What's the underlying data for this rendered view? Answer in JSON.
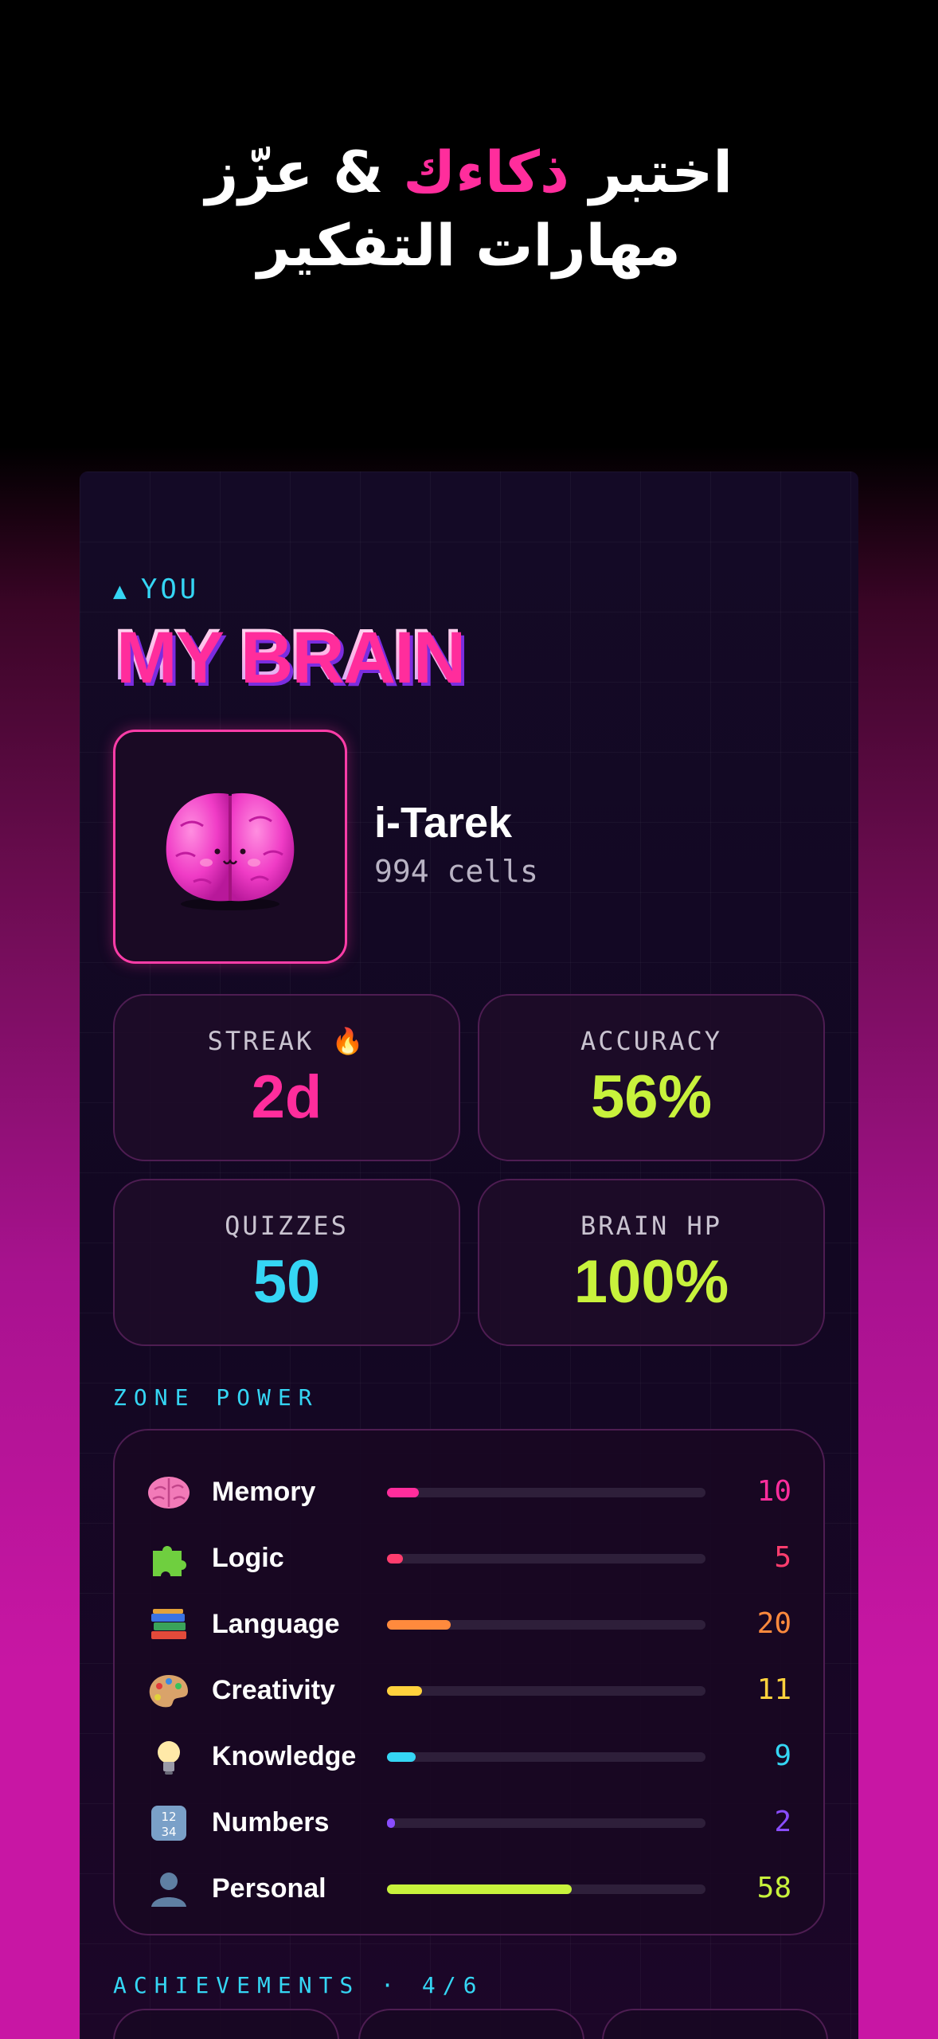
{
  "headline": {
    "line1_a": "اختبر ",
    "line1_accent": "ذكاءك",
    "line1_b": " & عزّز",
    "line2": "مهارات التفكير"
  },
  "profile": {
    "section_label": "YOU",
    "title": "MY BRAIN",
    "username": "i-Tarek",
    "cells": "994 cells"
  },
  "stats": [
    {
      "label": "STREAK 🔥",
      "value": "2d",
      "color": "#ff2d9c"
    },
    {
      "label": "ACCURACY",
      "value": "56%",
      "color": "#c8f23c"
    },
    {
      "label": "QUIZZES",
      "value": "50",
      "color": "#35d6f4"
    },
    {
      "label": "BRAIN HP",
      "value": "100%",
      "color": "#c8f23c"
    }
  ],
  "zone_power": {
    "label": "ZONE POWER",
    "zones": [
      {
        "icon": "brain-icon",
        "name": "Memory",
        "value": "10",
        "fraction": 0.1,
        "color": "#ff2d9c"
      },
      {
        "icon": "puzzle-icon",
        "name": "Logic",
        "value": "5",
        "fraction": 0.05,
        "color": "#ff3d6e"
      },
      {
        "icon": "books-icon",
        "name": "Language",
        "value": "20",
        "fraction": 0.2,
        "color": "#ff8a3d"
      },
      {
        "icon": "palette-icon",
        "name": "Creativity",
        "value": "11",
        "fraction": 0.11,
        "color": "#ffd23d"
      },
      {
        "icon": "lightbulb-icon",
        "name": "Knowledge",
        "value": "9",
        "fraction": 0.09,
        "color": "#35d6f4"
      },
      {
        "icon": "numbers-icon",
        "name": "Numbers",
        "value": "2",
        "fraction": 0.02,
        "color": "#8a4dff"
      },
      {
        "icon": "person-icon",
        "name": "Personal",
        "value": "58",
        "fraction": 0.58,
        "color": "#c8f23c"
      }
    ]
  },
  "achievements": {
    "label": "ACHIEVEMENTS · 4/6"
  }
}
